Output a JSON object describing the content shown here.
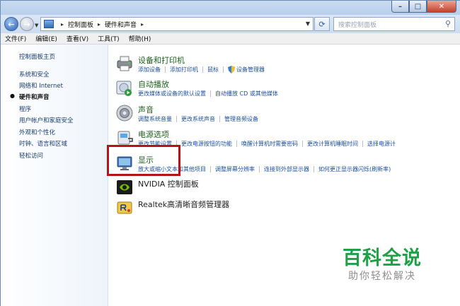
{
  "window": {
    "caption_min": "–",
    "caption_max": "□",
    "caption_close": "✕"
  },
  "address": {
    "crumbs": [
      "控制面板",
      "硬件和声音"
    ],
    "search_placeholder": "搜索控制面板"
  },
  "menu": [
    "文件(F)",
    "编辑(E)",
    "查看(V)",
    "工具(T)",
    "帮助(H)"
  ],
  "sidebar": {
    "items": [
      {
        "label": "控制面板主页",
        "current": false
      },
      {
        "label": "系统和安全",
        "current": false
      },
      {
        "label": "网络和 Internet",
        "current": false
      },
      {
        "label": "硬件和声音",
        "current": true
      },
      {
        "label": "程序",
        "current": false
      },
      {
        "label": "用户帐户和家庭安全",
        "current": false
      },
      {
        "label": "外观和个性化",
        "current": false
      },
      {
        "label": "时钟、语言和区域",
        "current": false
      },
      {
        "label": "轻松访问",
        "current": false
      }
    ]
  },
  "categories": [
    {
      "title": "设备和打印机",
      "icon": "printer-icon",
      "links": [
        "添加设备",
        "添加打印机",
        "鼠标",
        "设备管理器"
      ]
    },
    {
      "title": "自动播放",
      "icon": "autoplay-icon",
      "links": [
        "更改媒体或设备的默认设置",
        "自动播放 CD 或其他媒体"
      ]
    },
    {
      "title": "声音",
      "icon": "speaker-icon",
      "links": [
        "调整系统音量",
        "更改系统声音",
        "管理音频设备"
      ]
    },
    {
      "title": "电源选项",
      "icon": "power-icon",
      "links": [
        "更改节能设置",
        "更改电源按钮的功能",
        "唤醒计算机时需要密码",
        "更改计算机睡眠时间",
        "选择电源计"
      ]
    },
    {
      "title": "显示",
      "icon": "display-icon",
      "links": [
        "放大或缩小文本和其他项目",
        "调整屏幕分辨率",
        "连接到外部显示器",
        "如何更正显示器闪烁(刷新率)"
      ]
    },
    {
      "title": "NVIDIA 控制面板",
      "icon": "nvidia-icon",
      "links": []
    },
    {
      "title": "Realtek高清晰音频管理器",
      "icon": "realtek-icon",
      "links": []
    }
  ],
  "watermark": {
    "title": "百科全说",
    "subtitle": "助你轻松解决"
  },
  "colors": {
    "highlight": "#b31418",
    "category_title": "#1e5f1e",
    "link": "#1c4f9c"
  }
}
